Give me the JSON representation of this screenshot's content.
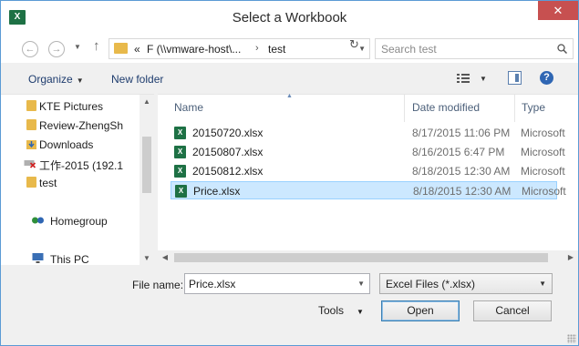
{
  "window": {
    "title": "Select a Workbook",
    "app_icon_label": "X",
    "close_glyph": "✕"
  },
  "navbar": {
    "back_glyph": "←",
    "forward_glyph": "→",
    "up_glyph": "↑",
    "address": {
      "overflow": "«",
      "segment1": "F (\\\\vmware-host\\...",
      "separator": "›",
      "segment2": "test"
    },
    "search_placeholder": "Search test"
  },
  "toolbar": {
    "organize_label": "Organize",
    "new_folder_label": "New folder",
    "help_glyph": "?"
  },
  "sidebar": {
    "items": [
      {
        "label": "KTE Pictures",
        "icon": "folder-icon"
      },
      {
        "label": "Review-ZhengSh",
        "icon": "folder-icon"
      },
      {
        "label": "Downloads",
        "icon": "downloads-folder-icon"
      },
      {
        "label": "工作-2015 (192.1",
        "icon": "network-drive-disconnected-icon"
      },
      {
        "label": "test",
        "icon": "folder-icon"
      },
      {
        "label": "Homegroup",
        "icon": "homegroup-icon"
      },
      {
        "label": "This PC",
        "icon": "computer-icon"
      }
    ]
  },
  "filelist": {
    "columns": {
      "name": "Name",
      "date": "Date modified",
      "type": "Type"
    },
    "rows": [
      {
        "name": "20150720.xlsx",
        "date": "8/17/2015 11:06 PM",
        "type": "Microsoft",
        "selected": false
      },
      {
        "name": "20150807.xlsx",
        "date": "8/16/2015 6:47 PM",
        "type": "Microsoft",
        "selected": false
      },
      {
        "name": "20150812.xlsx",
        "date": "8/18/2015 12:30 AM",
        "type": "Microsoft",
        "selected": false
      },
      {
        "name": "Price.xlsx",
        "date": "8/18/2015 12:30 AM",
        "type": "Microsoft",
        "selected": true
      }
    ]
  },
  "bottom": {
    "file_name_label": "File name:",
    "file_name_value": "Price.xlsx",
    "file_type_value": "Excel Files (*.xlsx)",
    "tools_label": "Tools",
    "open_label": "Open",
    "cancel_label": "Cancel"
  },
  "colors": {
    "accent": "#5b9bd5",
    "selection": "#cce8ff",
    "excel_green": "#1e7145",
    "close_red": "#c75050"
  }
}
